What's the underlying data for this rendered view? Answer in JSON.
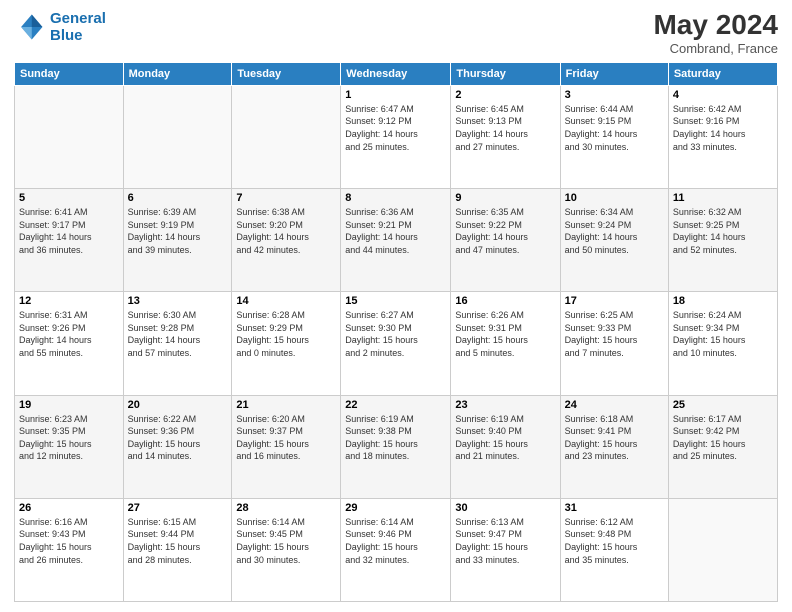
{
  "header": {
    "logo_line1": "General",
    "logo_line2": "Blue",
    "title": "May 2024",
    "subtitle": "Combrand, France"
  },
  "weekdays": [
    "Sunday",
    "Monday",
    "Tuesday",
    "Wednesday",
    "Thursday",
    "Friday",
    "Saturday"
  ],
  "weeks": [
    [
      {
        "day": "",
        "info": ""
      },
      {
        "day": "",
        "info": ""
      },
      {
        "day": "",
        "info": ""
      },
      {
        "day": "1",
        "info": "Sunrise: 6:47 AM\nSunset: 9:12 PM\nDaylight: 14 hours\nand 25 minutes."
      },
      {
        "day": "2",
        "info": "Sunrise: 6:45 AM\nSunset: 9:13 PM\nDaylight: 14 hours\nand 27 minutes."
      },
      {
        "day": "3",
        "info": "Sunrise: 6:44 AM\nSunset: 9:15 PM\nDaylight: 14 hours\nand 30 minutes."
      },
      {
        "day": "4",
        "info": "Sunrise: 6:42 AM\nSunset: 9:16 PM\nDaylight: 14 hours\nand 33 minutes."
      }
    ],
    [
      {
        "day": "5",
        "info": "Sunrise: 6:41 AM\nSunset: 9:17 PM\nDaylight: 14 hours\nand 36 minutes."
      },
      {
        "day": "6",
        "info": "Sunrise: 6:39 AM\nSunset: 9:19 PM\nDaylight: 14 hours\nand 39 minutes."
      },
      {
        "day": "7",
        "info": "Sunrise: 6:38 AM\nSunset: 9:20 PM\nDaylight: 14 hours\nand 42 minutes."
      },
      {
        "day": "8",
        "info": "Sunrise: 6:36 AM\nSunset: 9:21 PM\nDaylight: 14 hours\nand 44 minutes."
      },
      {
        "day": "9",
        "info": "Sunrise: 6:35 AM\nSunset: 9:22 PM\nDaylight: 14 hours\nand 47 minutes."
      },
      {
        "day": "10",
        "info": "Sunrise: 6:34 AM\nSunset: 9:24 PM\nDaylight: 14 hours\nand 50 minutes."
      },
      {
        "day": "11",
        "info": "Sunrise: 6:32 AM\nSunset: 9:25 PM\nDaylight: 14 hours\nand 52 minutes."
      }
    ],
    [
      {
        "day": "12",
        "info": "Sunrise: 6:31 AM\nSunset: 9:26 PM\nDaylight: 14 hours\nand 55 minutes."
      },
      {
        "day": "13",
        "info": "Sunrise: 6:30 AM\nSunset: 9:28 PM\nDaylight: 14 hours\nand 57 minutes."
      },
      {
        "day": "14",
        "info": "Sunrise: 6:28 AM\nSunset: 9:29 PM\nDaylight: 15 hours\nand 0 minutes."
      },
      {
        "day": "15",
        "info": "Sunrise: 6:27 AM\nSunset: 9:30 PM\nDaylight: 15 hours\nand 2 minutes."
      },
      {
        "day": "16",
        "info": "Sunrise: 6:26 AM\nSunset: 9:31 PM\nDaylight: 15 hours\nand 5 minutes."
      },
      {
        "day": "17",
        "info": "Sunrise: 6:25 AM\nSunset: 9:33 PM\nDaylight: 15 hours\nand 7 minutes."
      },
      {
        "day": "18",
        "info": "Sunrise: 6:24 AM\nSunset: 9:34 PM\nDaylight: 15 hours\nand 10 minutes."
      }
    ],
    [
      {
        "day": "19",
        "info": "Sunrise: 6:23 AM\nSunset: 9:35 PM\nDaylight: 15 hours\nand 12 minutes."
      },
      {
        "day": "20",
        "info": "Sunrise: 6:22 AM\nSunset: 9:36 PM\nDaylight: 15 hours\nand 14 minutes."
      },
      {
        "day": "21",
        "info": "Sunrise: 6:20 AM\nSunset: 9:37 PM\nDaylight: 15 hours\nand 16 minutes."
      },
      {
        "day": "22",
        "info": "Sunrise: 6:19 AM\nSunset: 9:38 PM\nDaylight: 15 hours\nand 18 minutes."
      },
      {
        "day": "23",
        "info": "Sunrise: 6:19 AM\nSunset: 9:40 PM\nDaylight: 15 hours\nand 21 minutes."
      },
      {
        "day": "24",
        "info": "Sunrise: 6:18 AM\nSunset: 9:41 PM\nDaylight: 15 hours\nand 23 minutes."
      },
      {
        "day": "25",
        "info": "Sunrise: 6:17 AM\nSunset: 9:42 PM\nDaylight: 15 hours\nand 25 minutes."
      }
    ],
    [
      {
        "day": "26",
        "info": "Sunrise: 6:16 AM\nSunset: 9:43 PM\nDaylight: 15 hours\nand 26 minutes."
      },
      {
        "day": "27",
        "info": "Sunrise: 6:15 AM\nSunset: 9:44 PM\nDaylight: 15 hours\nand 28 minutes."
      },
      {
        "day": "28",
        "info": "Sunrise: 6:14 AM\nSunset: 9:45 PM\nDaylight: 15 hours\nand 30 minutes."
      },
      {
        "day": "29",
        "info": "Sunrise: 6:14 AM\nSunset: 9:46 PM\nDaylight: 15 hours\nand 32 minutes."
      },
      {
        "day": "30",
        "info": "Sunrise: 6:13 AM\nSunset: 9:47 PM\nDaylight: 15 hours\nand 33 minutes."
      },
      {
        "day": "31",
        "info": "Sunrise: 6:12 AM\nSunset: 9:48 PM\nDaylight: 15 hours\nand 35 minutes."
      },
      {
        "day": "",
        "info": ""
      }
    ]
  ]
}
